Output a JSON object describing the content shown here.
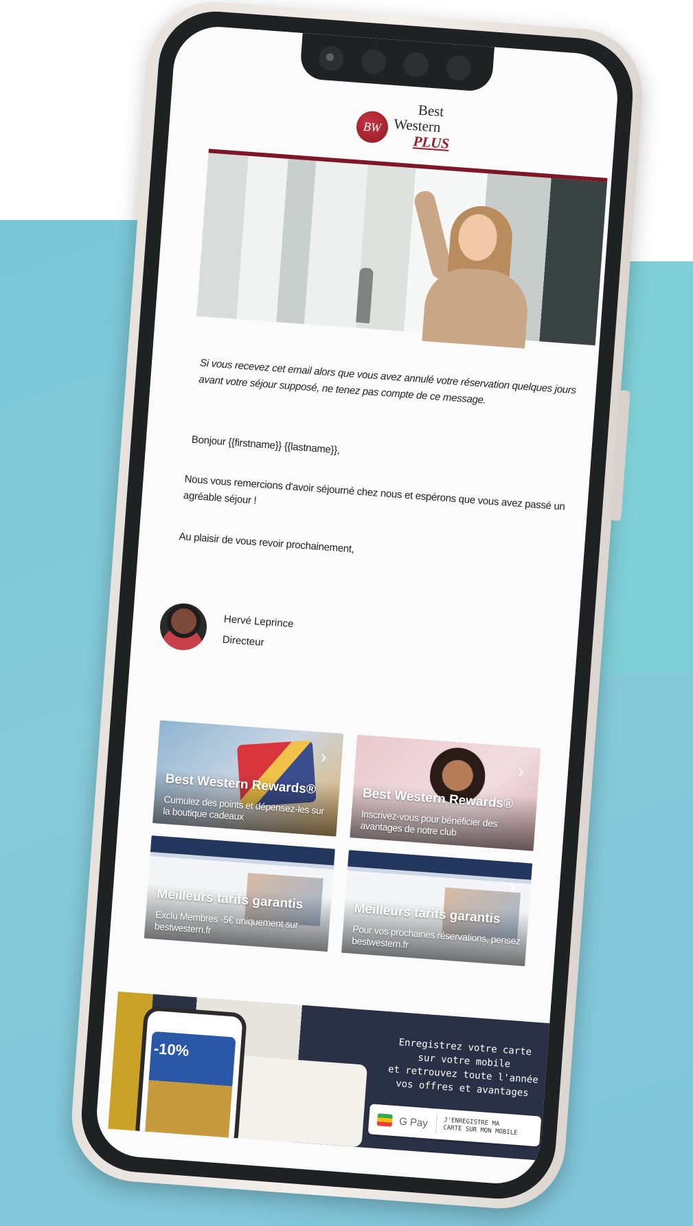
{
  "logo": {
    "badge": "BW",
    "line1": "Best",
    "line2": "Western",
    "line3": "PLUS"
  },
  "email": {
    "notice": "Si vous recevez cet email alors que vous avez annulé votre réservation quelques jours avant votre séjour supposé, ne tenez pas compte de ce message.",
    "greeting": "Bonjour {{firstname}} {{lastname}},",
    "paragraph": "Nous vous remercions d'avoir séjourné chez nous et espérons que vous avez passé un agréable séjour !",
    "closing": "Au plaisir de vous revoir prochainement,",
    "signature": {
      "name": "Hervé Leprince",
      "title": "Directeur"
    }
  },
  "cards": [
    {
      "title": "Best Western Rewards®",
      "subtitle": "Cumulez des points et dépensez-les sur la boutique cadeaux"
    },
    {
      "title": "Best Western Rewards®",
      "subtitle": "Inscrivez-vous pour bénéficier des avantages de notre club"
    },
    {
      "title": "Meilleurs tarifs garantis",
      "subtitle": "Exclu Membres -5€ uniquement sur bestwestern.fr"
    },
    {
      "title": "Meilleurs tarifs garantis",
      "subtitle": "Pour vos prochaines réservations, pensez bestwestern.fr"
    }
  ],
  "banner": {
    "text_line1": "Enregistrez votre carte",
    "text_line2": "sur votre mobile",
    "text_line3": "et retrouvez toute l'année",
    "text_line4": "vos offres et avantages",
    "discount": "-10%",
    "gpay_label": "G Pay",
    "gpay_cta": "J'ENREGISTRE MA CARTE SUR MON MOBILE"
  },
  "icons": {
    "chevron": "chevron-right-icon",
    "wallet": "wallet-icon"
  },
  "colors": {
    "brand_red": "#9b1c2b",
    "background_teal": "#7fc4d8",
    "phone_frame": "#e8e2dd"
  }
}
